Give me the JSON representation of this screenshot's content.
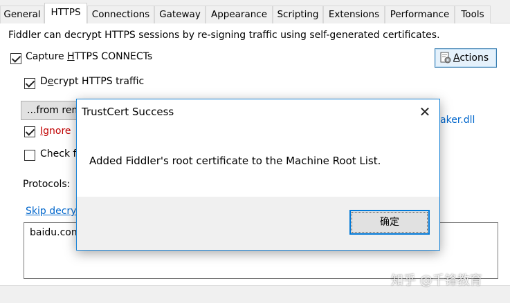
{
  "tabs": [
    {
      "label": "General",
      "active": false
    },
    {
      "label": "HTTPS",
      "active": true
    },
    {
      "label": "Connections",
      "active": false
    },
    {
      "label": "Gateway",
      "active": false
    },
    {
      "label": "Appearance",
      "active": false
    },
    {
      "label": "Scripting",
      "active": false
    },
    {
      "label": "Extensions",
      "active": false
    },
    {
      "label": "Performance",
      "active": false
    },
    {
      "label": "Tools",
      "active": false
    }
  ],
  "https": {
    "description": "Fiddler can decrypt HTTPS sessions by re-signing traffic using self-generated certificates.",
    "capture_connects": {
      "pre": "Capture ",
      "accel": "H",
      "post": "TTPS CONNECTs",
      "checked": true
    },
    "decrypt_traffic": {
      "pre": "D",
      "accel": "e",
      "post": "crypt HTTPS traffic",
      "checked": true
    },
    "from_dropdown": "...from rem",
    "ignore": {
      "accel": "I",
      "post": "gnore",
      "checked": true
    },
    "check": {
      "label": "Check f",
      "checked": false
    },
    "protocols_label": "Protocols:",
    "skip_link": "Skip decry",
    "skip_list": "baidu.com",
    "cert_maker": "aker.dll",
    "actions_button": {
      "accel": "A",
      "post": "ctions",
      "icon": "certificate-gear-icon"
    }
  },
  "dialog": {
    "title": "TrustCert Success",
    "close_glyph": "✕",
    "message": "Added Fiddler's root certificate to the Machine Root List.",
    "ok_label": "确定"
  },
  "watermark": "知乎 @千锋教育",
  "colors": {
    "dialog_border": "#1883d7",
    "link": "#0066cc",
    "warning_text": "#c00000",
    "button_focus": "#0078d7"
  }
}
